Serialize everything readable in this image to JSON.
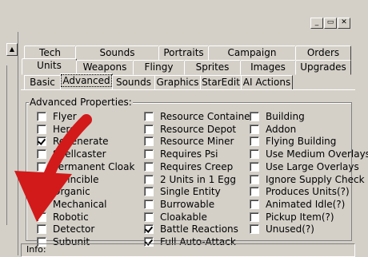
{
  "window": {
    "buttons": [
      "_",
      "▭",
      "✕"
    ]
  },
  "tabs_row1": [
    "Tech",
    "Sounds",
    "Portraits",
    "Campaign",
    "Orders"
  ],
  "tabs_row2": [
    "Units",
    "Weapons",
    "Flingy",
    "Sprites",
    "Images",
    "Upgrades"
  ],
  "subtabs": [
    "Basic",
    "Advanced",
    "Sounds",
    "Graphics",
    "StarEdit",
    "AI Actions"
  ],
  "group_label": "Advanced Properties:",
  "col1": [
    {
      "label": "Flyer",
      "checked": false
    },
    {
      "label": "Hero",
      "checked": false
    },
    {
      "label": "Regenerate",
      "checked": true
    },
    {
      "label": "Spellcaster",
      "checked": false
    },
    {
      "label": "Permanent Cloak",
      "checked": false
    },
    {
      "label": "Invincible",
      "checked": false
    },
    {
      "label": "Organic",
      "checked": true
    },
    {
      "label": "Mechanical",
      "checked": true
    },
    {
      "label": "Robotic",
      "checked": false
    },
    {
      "label": "Detector",
      "checked": false
    },
    {
      "label": "Subunit",
      "checked": false
    }
  ],
  "col2": [
    {
      "label": "Resource Container",
      "checked": false
    },
    {
      "label": "Resource Depot",
      "checked": false
    },
    {
      "label": "Resource Miner",
      "checked": false
    },
    {
      "label": "Requires Psi",
      "checked": false
    },
    {
      "label": "Requires Creep",
      "checked": false
    },
    {
      "label": "2 Units in 1 Egg",
      "checked": false
    },
    {
      "label": "Single Entity",
      "checked": false
    },
    {
      "label": "Burrowable",
      "checked": false
    },
    {
      "label": "Cloakable",
      "checked": false
    },
    {
      "label": "Battle Reactions",
      "checked": true
    },
    {
      "label": "Full Auto-Attack",
      "checked": true
    }
  ],
  "col3": [
    {
      "label": "Building",
      "checked": false
    },
    {
      "label": "Addon",
      "checked": false
    },
    {
      "label": "Flying Building",
      "checked": false
    },
    {
      "label": "Use Medium Overlays",
      "checked": false
    },
    {
      "label": "Use Large Overlays",
      "checked": false
    },
    {
      "label": "Ignore Supply Check",
      "checked": false
    },
    {
      "label": "Produces Units(?)",
      "checked": false
    },
    {
      "label": "Animated Idle(?)",
      "checked": false
    },
    {
      "label": "Pickup Item(?)",
      "checked": false
    },
    {
      "label": "Unused(?)",
      "checked": false
    }
  ],
  "info_label": "Info:",
  "colors": {
    "face": "#d4d0c8",
    "arrow": "#d21a1a"
  }
}
